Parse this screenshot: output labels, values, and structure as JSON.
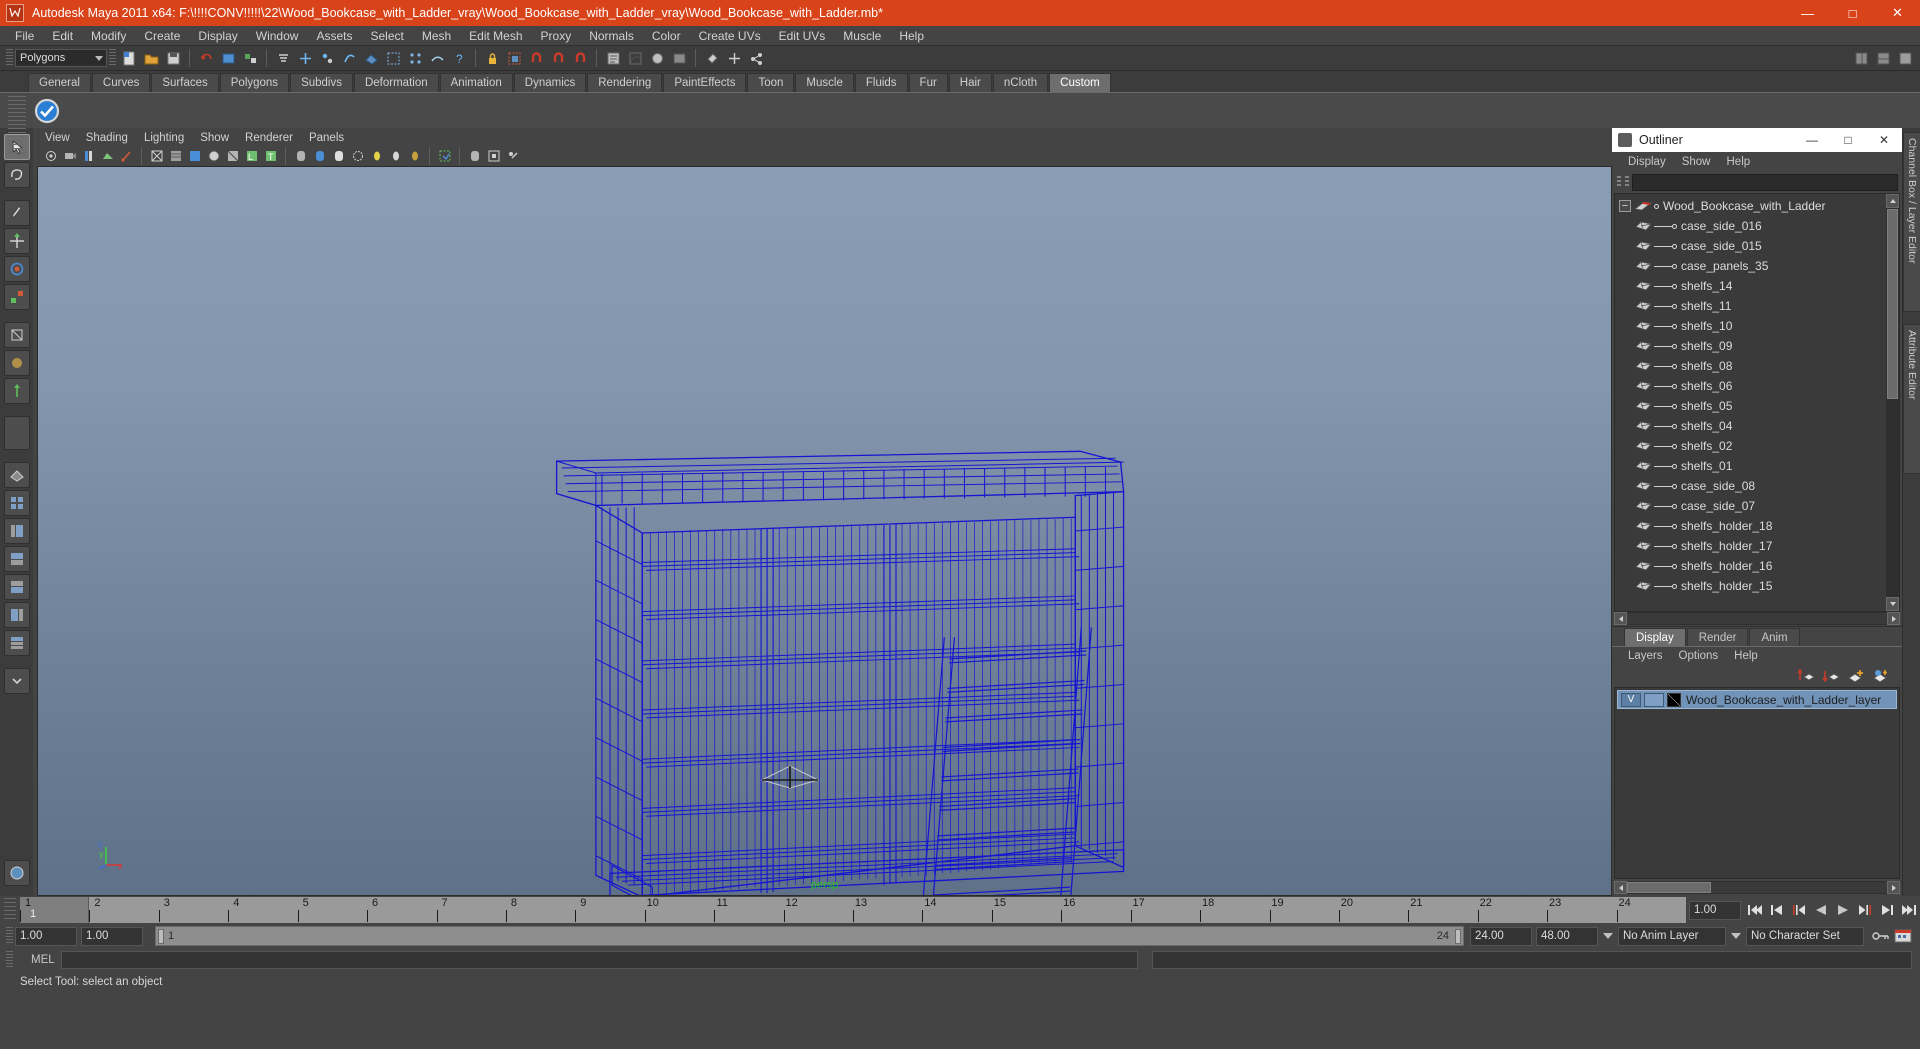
{
  "titlebar": {
    "title": "Autodesk Maya 2011 x64: F:\\!!!!CONV!!!!!\\22\\Wood_Bookcase_with_Ladder_vray\\Wood_Bookcase_with_Ladder_vray\\Wood_Bookcase_with_Ladder.mb*",
    "minimize": "—",
    "maximize": "□",
    "close": "✕"
  },
  "menubar": {
    "items": [
      "File",
      "Edit",
      "Modify",
      "Create",
      "Display",
      "Window",
      "Assets",
      "Select",
      "Mesh",
      "Edit Mesh",
      "Proxy",
      "Normals",
      "Color",
      "Create UVs",
      "Edit UVs",
      "Muscle",
      "Help"
    ]
  },
  "statusline": {
    "menu_set": "Polygons"
  },
  "shelf": {
    "tabs": [
      "General",
      "Curves",
      "Surfaces",
      "Polygons",
      "Subdivs",
      "Deformation",
      "Animation",
      "Dynamics",
      "Rendering",
      "PaintEffects",
      "Toon",
      "Muscle",
      "Fluids",
      "Fur",
      "Hair",
      "nCloth",
      "Custom"
    ],
    "active_tab": "Custom"
  },
  "viewport": {
    "menu": [
      "View",
      "Shading",
      "Lighting",
      "Show",
      "Renderer",
      "Panels"
    ],
    "camera_label": "persp",
    "axis": {
      "x": "x",
      "y": "y",
      "z": "z"
    }
  },
  "outliner": {
    "title": "Outliner",
    "minimize": "—",
    "maximize": "□",
    "close": "✕",
    "menu": [
      "Display",
      "Show",
      "Help"
    ],
    "search_value": "",
    "root": "Wood_Bookcase_with_Ladder",
    "items": [
      "case_side_016",
      "case_side_015",
      "case_panels_35",
      "shelfs_14",
      "shelfs_11",
      "shelfs_10",
      "shelfs_09",
      "shelfs_08",
      "shelfs_06",
      "shelfs_05",
      "shelfs_04",
      "shelfs_02",
      "shelfs_01",
      "case_side_08",
      "case_side_07",
      "shelfs_holder_18",
      "shelfs_holder_17",
      "shelfs_holder_16",
      "shelfs_holder_15"
    ]
  },
  "layer_editor": {
    "tabs": [
      "Display",
      "Render",
      "Anim"
    ],
    "active_tab": "Display",
    "menu": [
      "Layers",
      "Options",
      "Help"
    ],
    "layers": [
      {
        "visibility": "V",
        "playback": "",
        "name": "Wood_Bookcase_with_Ladder_layer"
      }
    ]
  },
  "right_tabs": [
    "Channel Box / Layer Editor",
    "Attribute Editor"
  ],
  "time_slider": {
    "ticks": [
      1,
      2,
      3,
      4,
      5,
      6,
      7,
      8,
      9,
      10,
      11,
      12,
      13,
      14,
      15,
      16,
      17,
      18,
      19,
      20,
      21,
      22,
      23,
      24
    ],
    "current_frame": "1",
    "playback_speed": "1.00"
  },
  "range_slider": {
    "start": "1.00",
    "end": "1.00",
    "range_start": "1",
    "range_end": "24",
    "anim_end": "24.00",
    "playback_end": "48.00",
    "anim_layer": "No Anim Layer",
    "character_set": "No Character Set"
  },
  "command_line": {
    "label": "MEL",
    "value": ""
  },
  "help_line": {
    "text": "Select Tool: select an object"
  },
  "colors": {
    "title_bar": "#d8431a",
    "panel_bg": "#444444",
    "wireframe": "#1414d2",
    "layer_selected": "#7193b8",
    "camera_label": "#27c427"
  }
}
